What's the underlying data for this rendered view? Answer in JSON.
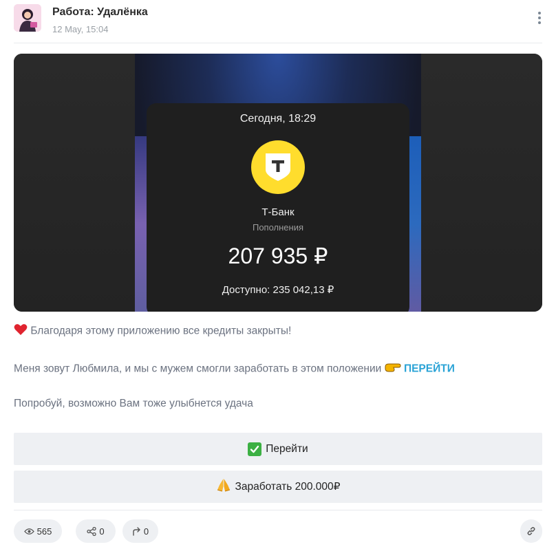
{
  "post": {
    "channel_title": "Работа: Удалёнка",
    "date": "12 May, 15:04"
  },
  "media": {
    "time": "Сегодня, 18:29",
    "bank_name": "Т-Банк",
    "bank_subtitle": "Пополнения",
    "amount": "207 935 ₽",
    "available": "Доступно: 235 042,13 ₽",
    "bank_color": "#ffdd2d"
  },
  "text": {
    "line1": "Благодаря этому приложению все кредиты закрыты!",
    "line2": "Меня зовут Любмила, и мы с мужем смогли заработать в этом положении",
    "line2_link": "ПЕРЕЙТИ",
    "line3": "Попробуй, возможно Вам тоже улыбнется удача"
  },
  "buttons": [
    {
      "label": "Перейти",
      "icon": "check-mark-icon"
    },
    {
      "label": "Заработать 200.000₽",
      "icon": "folded-hands-icon"
    }
  ],
  "footer": {
    "views": "565",
    "reactions": "0",
    "shares": "0"
  },
  "colors": {
    "link": "#2aa3d6",
    "button_bg": "#eef0f3"
  }
}
